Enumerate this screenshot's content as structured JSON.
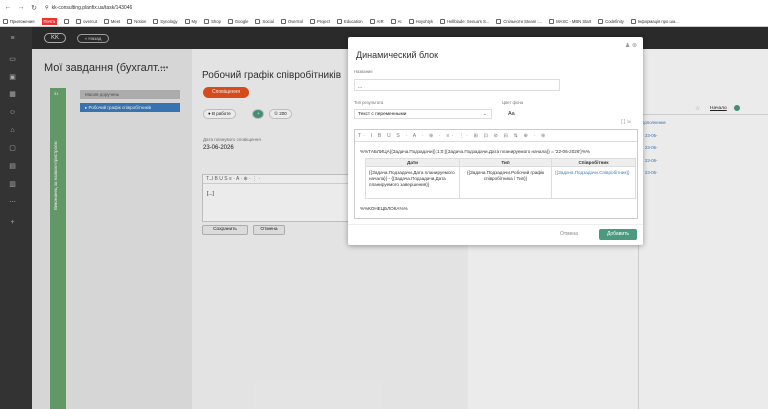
{
  "browser": {
    "url": "kk-consulting.planfix.ua/task/143046",
    "bookmarks": [
      "Приложения",
      "Почта",
      "",
      "overcut",
      "Meet",
      "Notion",
      "Synology",
      "My",
      "Shop",
      "Google",
      "Social",
      "OverSol",
      "Project",
      "Education",
      "AIR",
      "AI",
      "Hoyohtyk",
      "Hellblade: Senua's S...",
      "Спільноти Steam :...",
      "MASC - MBN Start",
      "Codefinity",
      "Інформація про ша..."
    ]
  },
  "app": {
    "logo": "KK",
    "back_label": "« Назад"
  },
  "left": {
    "title": "Мої завдання (бухгалт...",
    "dots": "•••",
    "vertical": "Виконанец за назвою-пристроєм",
    "num": "31",
    "card1": "Масив доручень",
    "card2": "▸ Робочий графік співробітників"
  },
  "task": {
    "title": "Робочий графік співробітників",
    "status": "Сповіщення",
    "chip1": "● В работе",
    "chip2": "① 200",
    "date_label": "Дата планувого сповіщення",
    "date_value": "23-06-2026",
    "editor_toolbar": "T ̶ I B U S ≡ · A · ⊕ ·  ⋮ ·",
    "editor_text": "[...]",
    "save": "Сохранить",
    "cancel": "Отмена"
  },
  "right": {
    "col_header": "Начало",
    "rows": [
      "дополнение",
      "23-06-",
      "23-06-",
      "23-06-",
      "23-06-"
    ]
  },
  "modal": {
    "title": "Динамический блок",
    "name_label": "Название",
    "name_value": "...",
    "type_label": "Тип результата",
    "type_value": "Текст с переменными",
    "bg_label": "Цвет фона",
    "bg_value": "Aa",
    "toolbar": "T· I B U S · A · ⊕ · ≡· ⋮· ⊞ ⊡ ⊘ ⊟ ⇅ ⊕ · ⊛",
    "line1": "%%ТАБЛИЦА{{Задача.Подзадачи}};1;0;{{Задача.Подзадачи.Дата планируемого начала}} = '22-06-2026'}%%",
    "headers": [
      "Дати",
      "Тип",
      "Співробітник"
    ],
    "cell1": "{{Задача.Подзадачи.Дата планируемого начала}} - {{Задача.Подзадачи.Дата планируемого завершения}}",
    "cell2": "{{Задача.Подзадачи.Робочий графік співробітника / Тип}}",
    "cell3": "{{Задача.Подзадачи.Співробітник}}",
    "line2": "%%КОНЕЦБЛОКА%%",
    "cancel": "Отмена",
    "add": "Добавить"
  }
}
